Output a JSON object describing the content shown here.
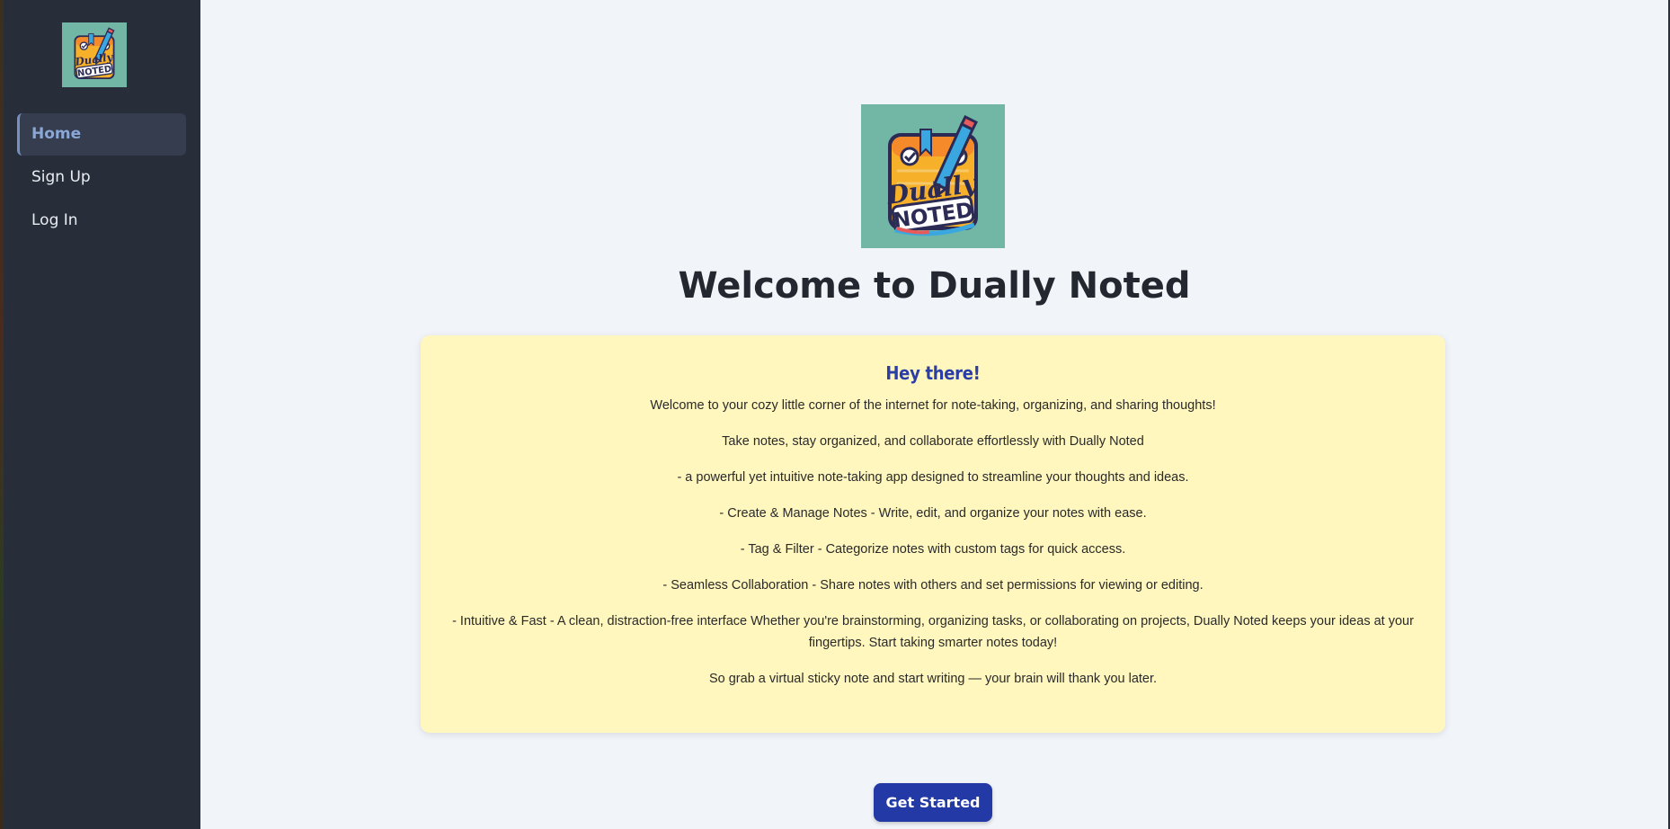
{
  "app": {
    "logo_text_top": "Dually",
    "logo_text_bottom": "NOTED"
  },
  "sidebar": {
    "items": [
      {
        "label": "Home",
        "active": true
      },
      {
        "label": "Sign Up",
        "active": false
      },
      {
        "label": "Log In",
        "active": false
      }
    ]
  },
  "main": {
    "title": "Welcome to Dually Noted",
    "card": {
      "heading": "Hey there!",
      "paragraphs": [
        "Welcome to your cozy little corner of the internet for note-taking, organizing, and sharing thoughts!",
        "Take notes, stay organized, and collaborate effortlessly with Dually Noted",
        "- a powerful yet intuitive note-taking app designed to streamline your thoughts and ideas.",
        "- Create & Manage Notes - Write, edit, and organize your notes with ease.",
        "- Tag & Filter - Categorize notes with custom tags for quick access.",
        "- Seamless Collaboration - Share notes with others and set permissions for viewing or editing.",
        "- Intuitive & Fast - A clean, distraction-free interface Whether you're brainstorming, organizing tasks, or collaborating on projects, Dually Noted keeps your ideas at your fingertips. Start taking smarter notes today!",
        "So grab a virtual sticky note and start writing — your brain will thank you later."
      ]
    },
    "cta_label": "Get Started"
  },
  "colors": {
    "sidebar_bg": "#282d3a",
    "accent": "#2339a6",
    "card_bg": "#fff7bd",
    "active_nav_text": "#8aa7d6"
  }
}
